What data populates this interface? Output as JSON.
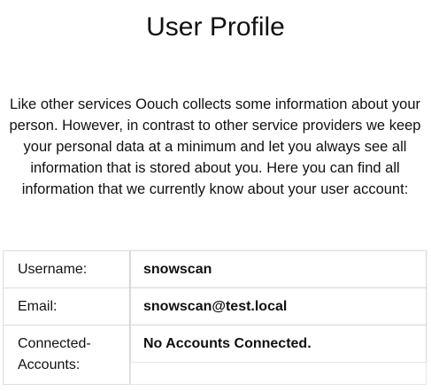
{
  "page": {
    "title": "User Profile",
    "intro": "Like other services Oouch collects some information about your person. However, in contrast to other service providers we keep your personal data at a minimum and let you always see all information that is stored about you. Here you can find all information that we currently know about your user account:"
  },
  "profile": {
    "rows": [
      {
        "label": "Username:",
        "value": "snowscan"
      },
      {
        "label": "Email:",
        "value": "snowscan@test.local"
      },
      {
        "label": "Connected-Accounts:",
        "value": "No Accounts Connected."
      }
    ]
  }
}
